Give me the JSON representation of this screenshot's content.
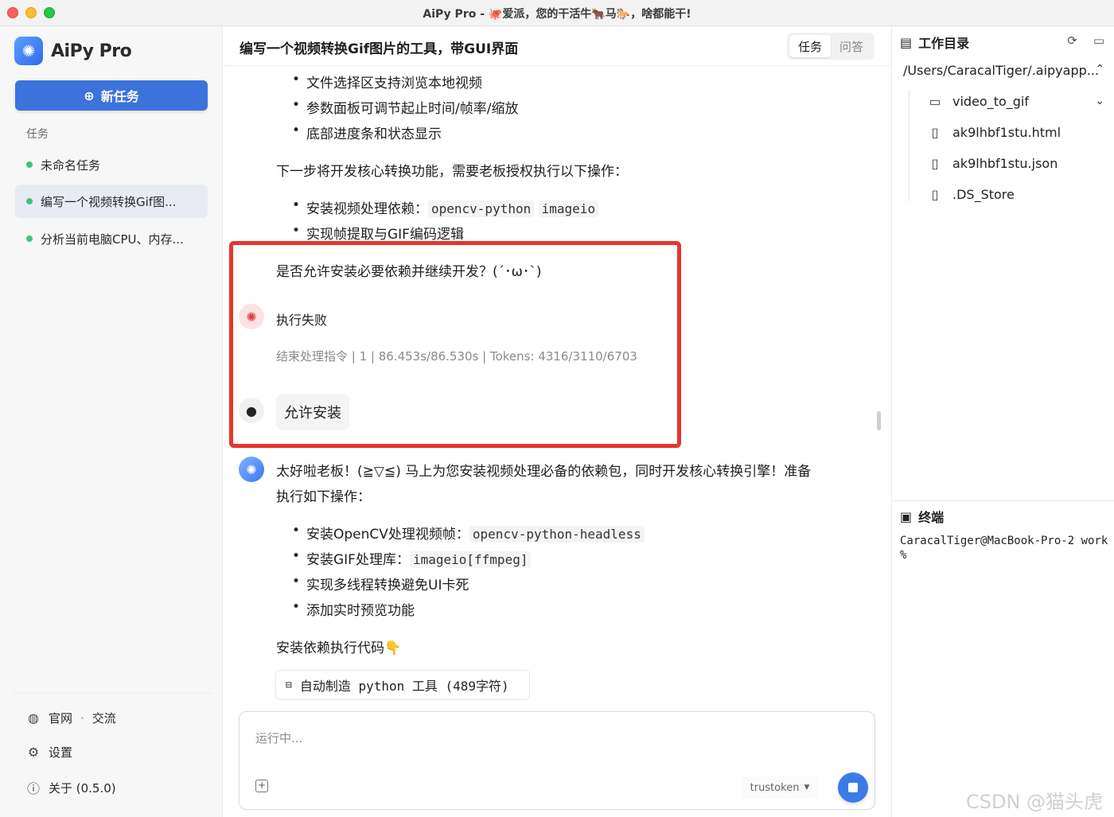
{
  "window": {
    "title": "AiPy Pro - 🐙爱派，您的干活牛🐂马🐎，啥都能干!"
  },
  "sidebar": {
    "brand": "AiPy Pro",
    "new_task": "新任务",
    "section_label": "任务",
    "tasks": [
      {
        "label": "未命名任务"
      },
      {
        "label": "编写一个视频转换Gif图..."
      },
      {
        "label": "分析当前电脑CPU、内存..."
      }
    ],
    "links": {
      "site": "官网",
      "sep": "·",
      "community": "交流",
      "settings": "设置",
      "about": "关于 (0.5.0)"
    }
  },
  "main": {
    "title": "编写一个视频转换Gif图片的工具，带GUI界面",
    "tabs": [
      {
        "label": "任务"
      },
      {
        "label": "问答"
      }
    ],
    "messages": {
      "bullets_top": [
        "文件选择区支持浏览本地视频",
        "参数面板可调节起止时间/帧率/缩放",
        "底部进度条和状态显示"
      ],
      "next_step": "下一步将开发核心转换功能，需要老板授权执行以下操作：",
      "dep_label": "安装视频处理依赖：",
      "dep_code1": "opencv-python",
      "dep_code2": "imageio",
      "gif_logic": "实现帧提取与GIF编码逻辑",
      "ask": "是否允许安装必要依赖并继续开发？(´･ω･`)",
      "fail_title": "执行失败",
      "fail_meta": "结束处理指令 | 1 | 86.453s/86.530s | Tokens: 4316/3110/6703",
      "user_reply": "允许安装",
      "bot_line1": "太好啦老板！(≧▽≦) 马上为您安装视频处理必备的依赖包，同时开发核心转换引擎！准备",
      "bot_line2": "执行如下操作：",
      "b1_label": "安装OpenCV处理视频帧：",
      "b1_code": "opencv-python-headless",
      "b2_label": "安装GIF处理库：",
      "b2_code": "imageio[ffmpeg]",
      "b3": "实现多线程转换避免UI卡死",
      "b4": "添加实时预览功能",
      "install_code": "安装依赖执行代码👇",
      "tool_card": "自动制造 python 工具 (489字符)"
    },
    "input": {
      "placeholder": "运行中...",
      "model": "trustoken"
    }
  },
  "right": {
    "workdir_title": "工作目录",
    "path": "/Users/CaracalTiger/.aipyapp...",
    "tree": [
      {
        "name": "video_to_gif",
        "icon": "folder-icon"
      },
      {
        "name": "ak9lhbf1stu.html",
        "icon": "file-icon"
      },
      {
        "name": "ak9lhbf1stu.json",
        "icon": "file-icon"
      },
      {
        "name": ".DS_Store",
        "icon": "file-icon"
      }
    ],
    "terminal_title": "终端",
    "terminal_text": "CaracalTiger@MacBook-Pro-2 work %"
  },
  "watermark": "CSDN @猫头虎",
  "colors": {
    "accent": "#3b73db",
    "highlight": "#e8352b",
    "status_dot": "#3cc77e"
  }
}
